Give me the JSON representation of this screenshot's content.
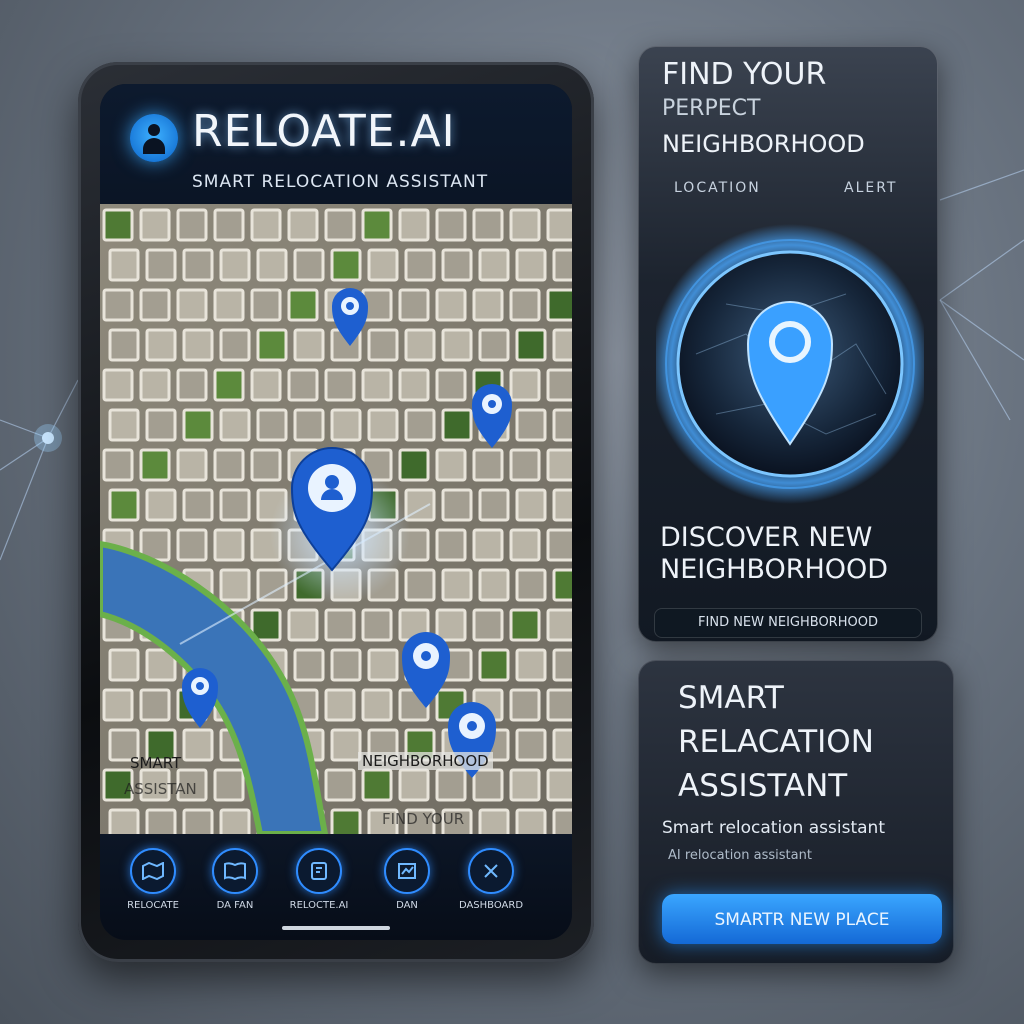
{
  "app": {
    "title": "RELOATE.AI",
    "subtitle": "SMART RELOCATION ASSISTANT"
  },
  "map": {
    "labels": {
      "smart_assistant_1": "SMART",
      "smart_assistant_2": "ASSISTAN",
      "find_your": "FIND YOUR",
      "neighborhood": "NEIGHBORHOOD"
    }
  },
  "nav": {
    "items": [
      {
        "label": "RELOCATE",
        "icon": "map-icon"
      },
      {
        "label": "DA FAN",
        "icon": "book-icon"
      },
      {
        "label": "RELOCTE.AI",
        "icon": "document-icon"
      },
      {
        "label": "DAN",
        "icon": "chart-icon"
      },
      {
        "label": "DASHBOARD",
        "icon": "tools-icon"
      }
    ]
  },
  "panel_top": {
    "title_line1": "FIND YOUR",
    "title_line2": "PERPECT",
    "title_line3": "NEIGHBORHOOD",
    "mini_left": "LOCATION",
    "mini_right": "ALERT",
    "discover_line1": "DISCOVER  NEW",
    "discover_line2": "NEIGHBORHOOD",
    "search_text": "FIND NEW NEIGHBORHOOD"
  },
  "panel_bottom": {
    "title_line1": "SMART",
    "title_line2": "RELACATION",
    "title_line3": "ASSISTANT",
    "line1": "Smart relocation assistant",
    "line2": "AI relocation assistant",
    "cta_label": "SMARTR NEW PLACE"
  },
  "colors": {
    "accent": "#2f8cff",
    "pin": "#1e5fd0",
    "water": "#3a74b8",
    "background": "#6a7481"
  }
}
